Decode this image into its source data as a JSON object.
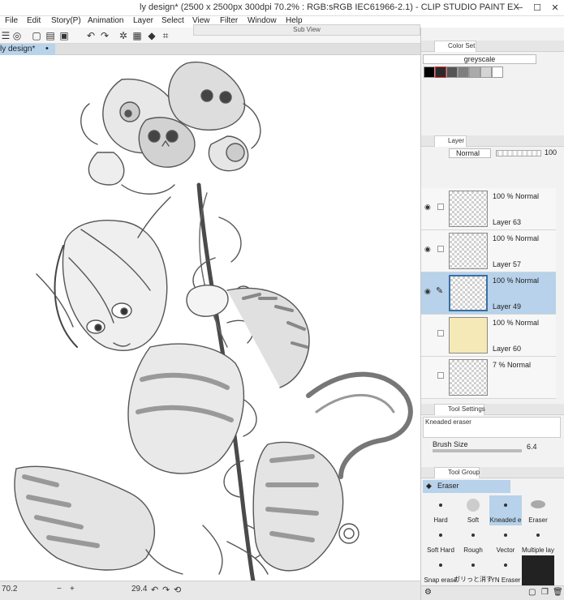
{
  "window": {
    "title": "ly design* (2500 x 2500px 300dpi 70.2% : RGB:sRGB IEC61966-2.1) - CLIP STUDIO PAINT EX",
    "minimize": "─",
    "maximize": "☐",
    "close": "✕"
  },
  "menu": [
    "File",
    "Edit",
    "Story(P)",
    "Animation",
    "Layer",
    "Select",
    "View",
    "Filter",
    "Window",
    "Help"
  ],
  "subview": {
    "title": "Sub View"
  },
  "document_tab": {
    "label": "ly design*",
    "dot": "•"
  },
  "status": {
    "zoom": "70.2",
    "angle": "29.4",
    "minus": "−",
    "plus": "+"
  },
  "color_set": {
    "tab_label": "Color Set",
    "preset": "greyscale",
    "swatches": [
      "#000000",
      "#2b2b2b",
      "#555555",
      "#7f7f7f",
      "#aaaaaa",
      "#d4d4d4",
      "#ffffff"
    ]
  },
  "layer_panel": {
    "tab_label": "Layer",
    "blend_mode": "Normal",
    "opacity": "100",
    "layers": [
      {
        "opacity": "100 % Normal",
        "name": "Layer 63",
        "selected": false
      },
      {
        "opacity": "100 % Normal",
        "name": "Layer 57",
        "selected": false
      },
      {
        "opacity": "100 % Normal",
        "name": "Layer 49",
        "selected": true
      },
      {
        "opacity": "100 % Normal",
        "name": "Layer 60",
        "selected": false
      },
      {
        "opacity": "7 % Normal",
        "name": "",
        "selected": false
      }
    ]
  },
  "tool_settings": {
    "tab_label": "Tool Settings",
    "tool_name": "Kneaded eraser",
    "brush_size_label": "Brush Size",
    "brush_size_value": "6.4"
  },
  "tool_group": {
    "tab_label": "Tool Group",
    "active_tool": "Eraser",
    "brushes": [
      {
        "label": "Hard"
      },
      {
        "label": "Soft"
      },
      {
        "label": "Kneaded e"
      },
      {
        "label": "Eraser"
      },
      {
        "label": "Soft Hard"
      },
      {
        "label": "Rough"
      },
      {
        "label": "Vector"
      },
      {
        "label": "Multiple lay"
      },
      {
        "label": "Snap erase"
      },
      {
        "label": "ガリっと消す鉛筆用消"
      },
      {
        "label": "YN Eraser"
      },
      {
        "label": ""
      }
    ]
  },
  "colors": {
    "accent": "#b7d2ea",
    "selected_layer": "#b7d2ea"
  }
}
